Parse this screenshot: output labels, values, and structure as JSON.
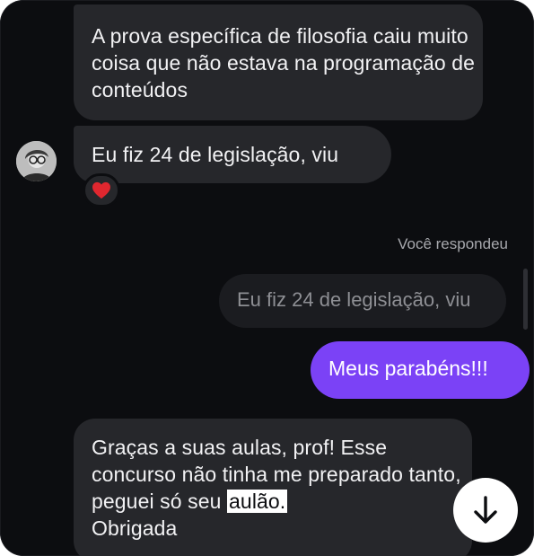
{
  "messages": {
    "m1": "A prova específica de filosofia caiu muito coisa que não estava na programação de conteúdos",
    "m2": "Eu fiz 24 de legislação, viu",
    "m2_reaction": "heart-icon",
    "reply_label": "Você respondeu",
    "quoted": "Eu fiz 24 de legislação, viu",
    "m3": "Meus parabéns!!!",
    "m4_before": "Graças a suas aulas, prof! Esse concurso não tinha me preparado tanto, peguei só seu",
    "m4_highlight": "aulão.",
    "m4_after": "Obrigada"
  },
  "colors": {
    "background": "#0c0d10",
    "incoming_bubble": "#26272b",
    "outgoing_bubble": "#7b42f6",
    "quoted_bubble": "#1b1c20",
    "heart": "#e0272f"
  },
  "icons": {
    "avatar": "contact-avatar",
    "scroll": "arrow-down-icon"
  }
}
